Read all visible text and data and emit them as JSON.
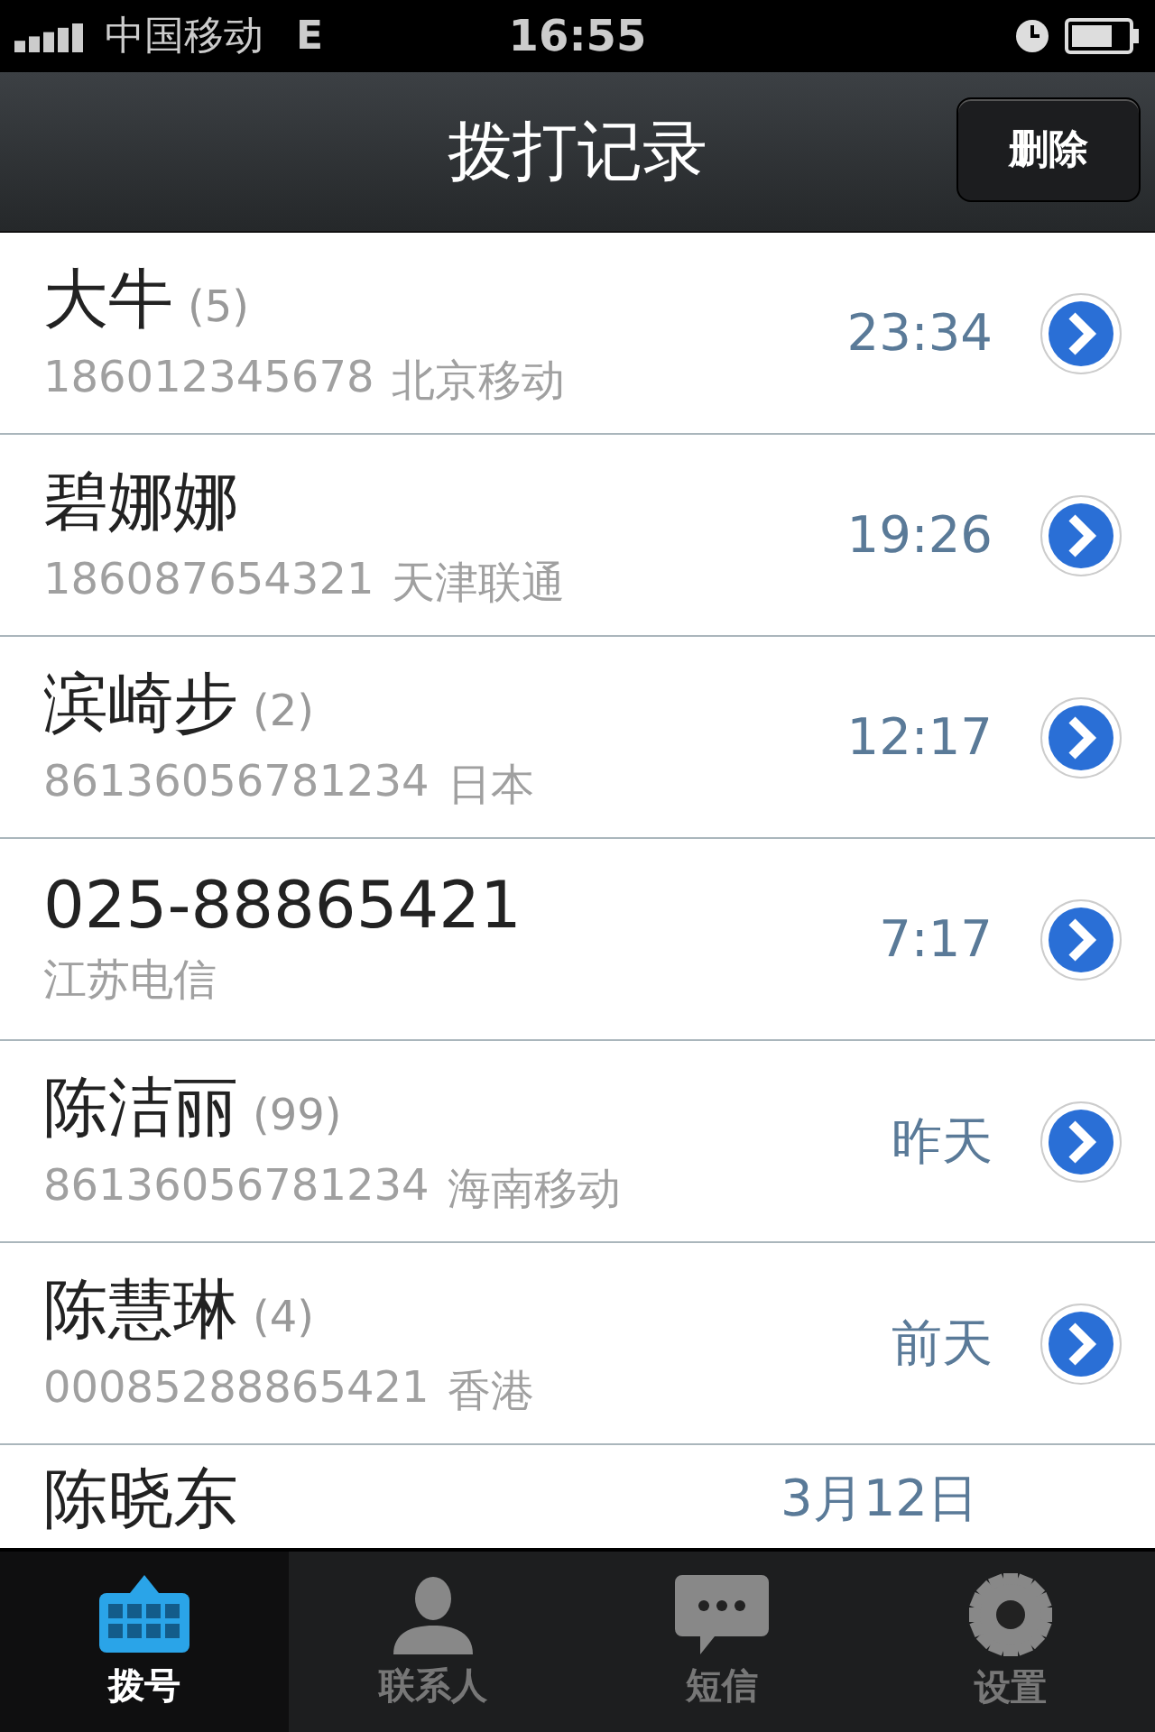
{
  "status_bar": {
    "carrier": "中国移动",
    "network": "E",
    "time": "16:55"
  },
  "nav": {
    "title": "拨打记录",
    "button": "删除"
  },
  "calls": [
    {
      "name": "大牛",
      "count": "(5)",
      "number": "186012345678",
      "location": "北京移动",
      "time": "23:34"
    },
    {
      "name": "碧娜娜",
      "number": "186087654321",
      "location": "天津联通",
      "time": "19:26"
    },
    {
      "name": "滨崎步",
      "count": "(2)",
      "number": "86136056781234",
      "location": "日本",
      "time": "12:17"
    },
    {
      "name": "025-88865421",
      "location": "江苏电信",
      "time": "7:17"
    },
    {
      "name": "陈洁丽",
      "count": "(99)",
      "number": "86136056781234",
      "location": "海南移动",
      "time": "昨天"
    },
    {
      "name": "陈慧琳",
      "count": "(4)",
      "number": "00085288865421",
      "location": "香港",
      "time": "前天"
    },
    {
      "name": "陈晓东",
      "time": "3月12日",
      "partial": true
    }
  ],
  "tabs": [
    {
      "label": "拨号",
      "kind": "keypad",
      "selected": true
    },
    {
      "label": "联系人",
      "kind": "contact",
      "selected": false
    },
    {
      "label": "短信",
      "kind": "message",
      "selected": false
    },
    {
      "label": "设置",
      "kind": "settings",
      "selected": false
    }
  ]
}
